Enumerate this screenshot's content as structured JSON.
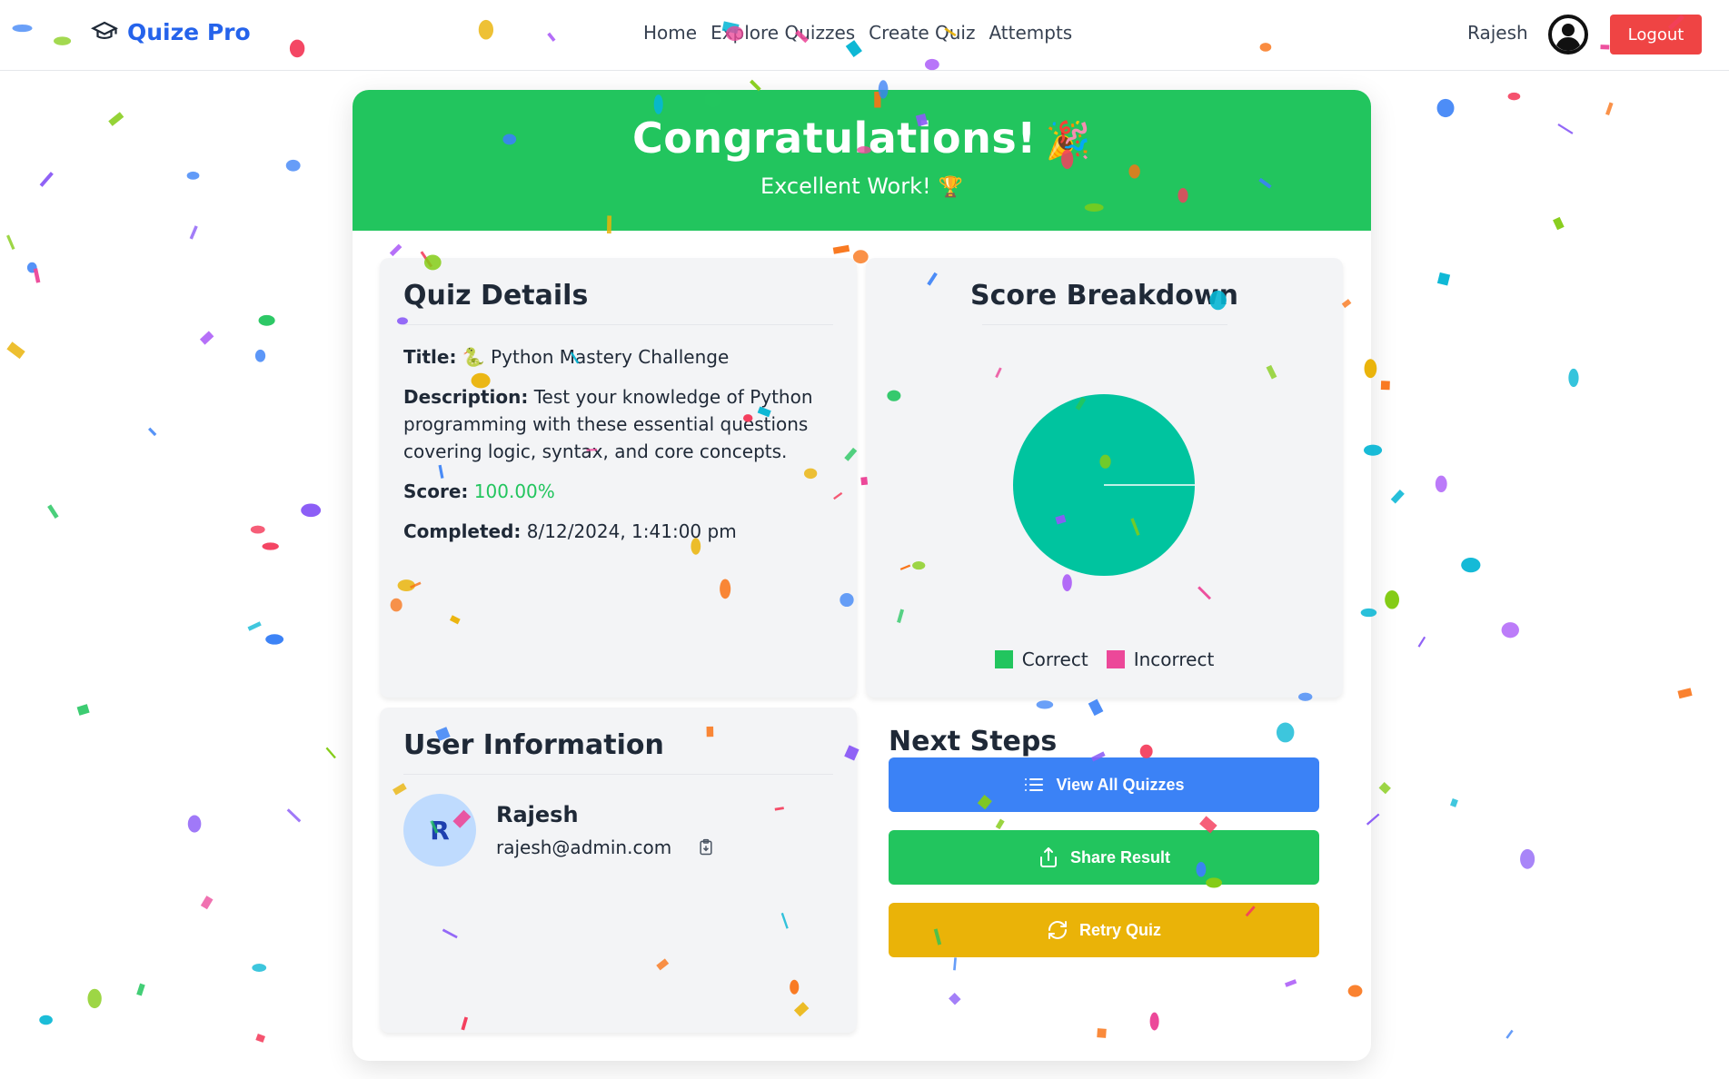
{
  "nav": {
    "brand": "Quize Pro",
    "brand_icon": "graduation-cap-icon",
    "links": [
      "Home",
      "Explore Quizzes",
      "Create Quiz",
      "Attempts"
    ],
    "user_name": "Rajesh",
    "avatar_icon": "user-circle-icon",
    "logout_label": "Logout"
  },
  "hero": {
    "title": "Congratulations!",
    "title_emoji": "🎉",
    "subtitle": "Excellent Work!",
    "subtitle_emoji": "🏆"
  },
  "quiz_details": {
    "heading": "Quiz Details",
    "title_label": "Title:",
    "title_icon": "🐍",
    "title_value": "Python Mastery Challenge",
    "description_label": "Description:",
    "description_value": "Test your knowledge of Python programming with these essential questions covering logic, syntax, and core concepts.",
    "score_label": "Score:",
    "score_value": "100.00%",
    "completed_label": "Completed:",
    "completed_value": "8/12/2024, 1:41:00 pm"
  },
  "score_breakdown": {
    "heading": "Score Breakdown",
    "legend": [
      {
        "label": "Correct",
        "color": "#22c55e"
      },
      {
        "label": "Incorrect",
        "color": "#ec4899"
      }
    ],
    "pie_color": "#00c49f"
  },
  "chart_data": {
    "type": "pie",
    "categories": [
      "Correct",
      "Incorrect"
    ],
    "values": [
      100,
      0
    ],
    "title": "Score Breakdown"
  },
  "user_info": {
    "heading": "User Information",
    "initial": "R",
    "name": "Rajesh",
    "email": "rajesh@admin.com",
    "copy_icon": "clipboard-icon"
  },
  "next_steps": {
    "heading": "Next Steps",
    "view_all_label": "View All Quizzes",
    "share_label": "Share Result",
    "retry_label": "Retry Quiz"
  },
  "colors": {
    "brand": "#2563eb",
    "hero": "#22c55e",
    "logout": "#ef4444",
    "btn_blue": "#3b82f6",
    "btn_green": "#22c55e",
    "btn_yellow": "#eab308"
  }
}
